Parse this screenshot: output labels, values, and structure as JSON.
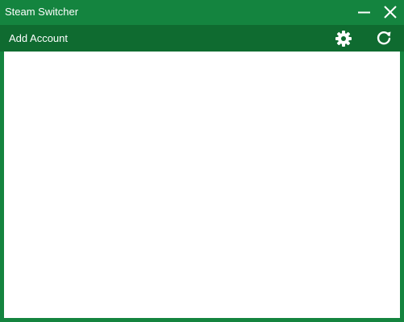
{
  "window": {
    "title": "Steam Switcher",
    "accent_color": "#14843f",
    "toolbar_color": "#0f6b30"
  },
  "titlebar": {
    "buttons": [
      {
        "name": "minimize",
        "icon": "minimize-icon"
      },
      {
        "name": "close",
        "icon": "close-icon"
      }
    ]
  },
  "toolbar": {
    "add_account_label": "Add Account",
    "settings_icon": "gear-icon",
    "refresh_icon": "refresh-icon"
  },
  "accounts": []
}
